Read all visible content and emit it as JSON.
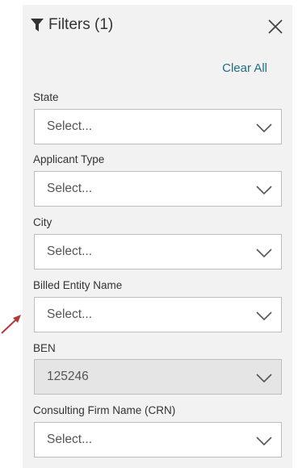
{
  "header": {
    "title": "Filters (1)",
    "clear_all_label": "Clear All"
  },
  "filters": [
    {
      "label": "State",
      "value": "Select..."
    },
    {
      "label": "Applicant Type",
      "value": "Select..."
    },
    {
      "label": "City",
      "value": "Select..."
    },
    {
      "label": "Billed Entity Name",
      "value": "Select..."
    },
    {
      "label": "BEN",
      "value": "125246"
    },
    {
      "label": "Consulting Firm Name (CRN)",
      "value": "Select..."
    }
  ],
  "icons": {
    "filter": "funnel-icon",
    "close": "close-icon",
    "dropdown": "chevron-down-icon",
    "annotation": "red-arrow-icon"
  },
  "colors": {
    "panel_bg": "#f2f2f2",
    "link": "#1b6f8a",
    "disabled_field_bg": "#e5e5e5",
    "annotation_arrow": "#b33a3a"
  }
}
